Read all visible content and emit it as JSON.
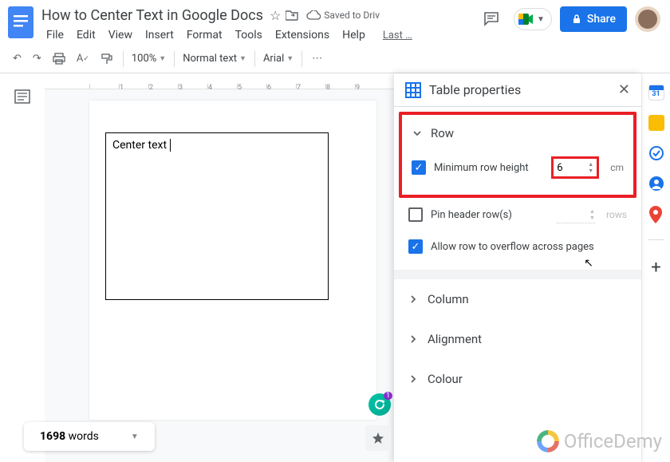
{
  "header": {
    "doc_title": "How to Center Text in Google Docs",
    "saved_status": "Saved to Driv",
    "menus": [
      "File",
      "Edit",
      "View",
      "Insert",
      "Format",
      "Tools",
      "Extensions",
      "Help"
    ],
    "last_edit": "Last …",
    "share_label": "Share"
  },
  "toolbar": {
    "zoom": "100%",
    "style": "Normal text",
    "font": "Arial"
  },
  "document": {
    "table_text": "Center text"
  },
  "panel": {
    "title": "Table properties",
    "row_label": "Row",
    "min_height_label": "Minimum row height",
    "min_height_value": "6",
    "min_height_unit": "cm",
    "pin_header_label": "Pin header row(s)",
    "pin_rows_unit": "rows",
    "overflow_label": "Allow row to overflow across pages",
    "column_label": "Column",
    "alignment_label": "Alignment",
    "colour_label": "Colour"
  },
  "footer": {
    "word_count_number": "1698",
    "word_count_label": "words"
  },
  "watermark": "OfficeDemy"
}
